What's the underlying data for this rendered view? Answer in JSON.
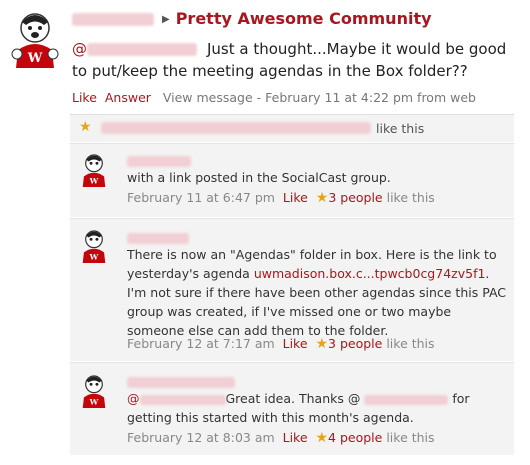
{
  "post": {
    "group": "Pretty Awesome Community",
    "at_sign": "@",
    "text": "Just a thought...Maybe it would be good to put/keep the meeting agendas in the Box folder??",
    "like": "Like",
    "answer": "Answer",
    "view_message": "View message",
    "timestamp": "February 11 at 4:22 pm from web",
    "likes_suffix": "like this"
  },
  "comments": [
    {
      "text": "with a link posted in the SocialCast group.",
      "time": "February 11 at 6:47 pm",
      "like": "Like",
      "people": "3 people",
      "like_this": "like this"
    },
    {
      "text_before": "There is now an \"Agendas\" folder in box.  Here is the link to yesterday's agenda ",
      "link": "uwmadison.box.c...tpwcb0cg74zv5f1",
      "text_after": ". I'm not sure if there have been other agendas since this PAC group was created, if I've missed one or two maybe someone else can add them to the folder.",
      "time": "February 12 at 7:17 am",
      "like": "Like",
      "people": "3 people",
      "like_this": "like this"
    },
    {
      "at_sign": "@",
      "text_mid": "Great idea.  Thanks @",
      "text_after": "for getting this started with this month's agenda.",
      "time": "February 12 at 8:03 am",
      "like": "Like",
      "people": "4 people",
      "like_this": "like this"
    }
  ]
}
